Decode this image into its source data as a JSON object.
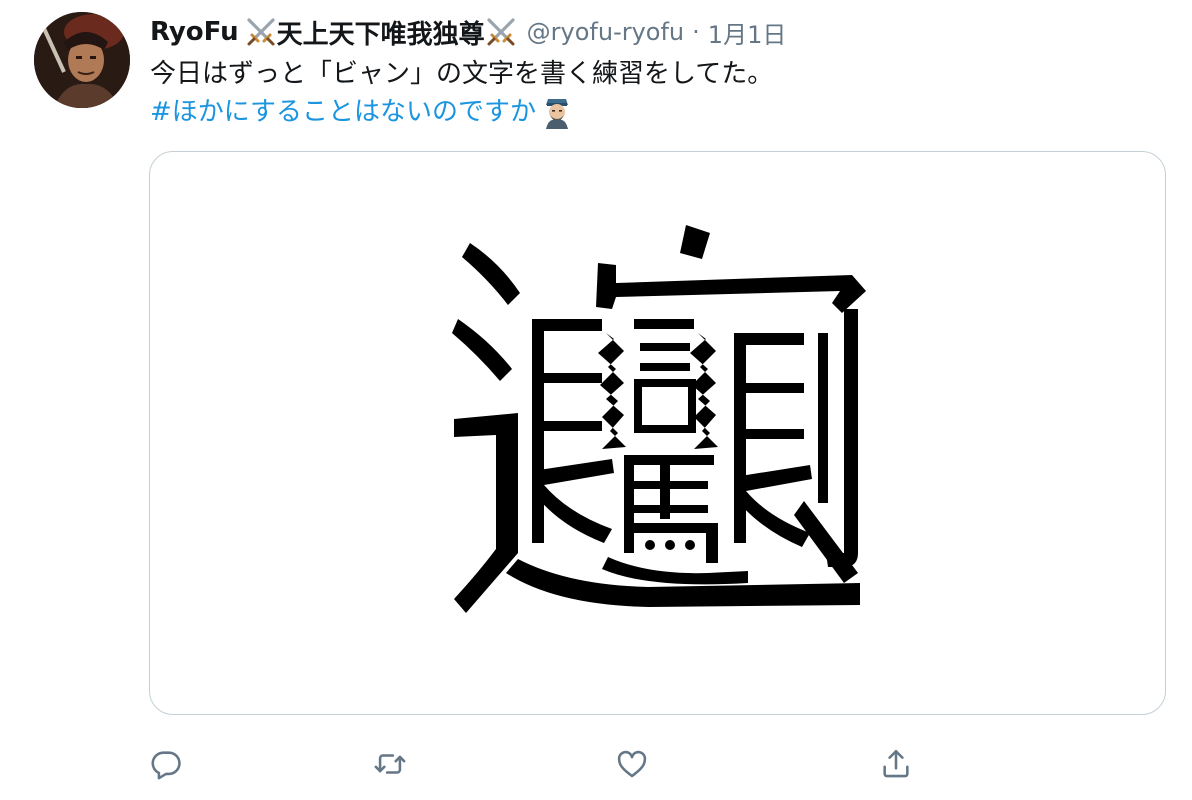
{
  "tweet": {
    "display_name": "RyoFu",
    "name_middle": "天上天下唯我独尊",
    "handle": "@ryofu-ryofu",
    "separator": "·",
    "date": "1月1日",
    "text": "今日はずっと「ビャン」の文字を書く練習をしてた。",
    "hashtag": "#ほかにすることはないのですか",
    "media_character": "𰻞"
  },
  "icons": {
    "name_decoration": "crossed-swords-icon",
    "hashtag_emoji": "bearded-man-face-icon",
    "reply": "reply-icon",
    "retweet": "retweet-icon",
    "like": "heart-icon",
    "share": "share-icon"
  },
  "colors": {
    "text_primary": "#14171a",
    "text_secondary": "#657786",
    "link": "#1b95e0",
    "icon": "#657786",
    "card_border": "#c4cfd6"
  }
}
